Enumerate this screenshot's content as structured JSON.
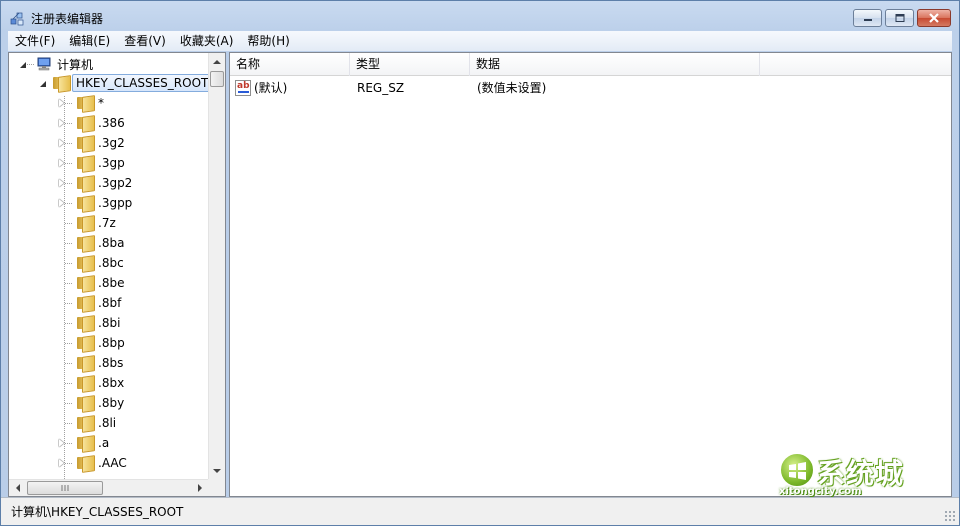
{
  "window": {
    "title": "注册表编辑器"
  },
  "menu": [
    {
      "label": "文件(F)"
    },
    {
      "label": "编辑(E)"
    },
    {
      "label": "查看(V)"
    },
    {
      "label": "收藏夹(A)"
    },
    {
      "label": "帮助(H)"
    }
  ],
  "tree": {
    "root_label": "计算机",
    "selected_label": "HKEY_CLASSES_ROOT",
    "children": [
      {
        "label": "*",
        "expandable": true
      },
      {
        "label": ".386",
        "expandable": true
      },
      {
        "label": ".3g2",
        "expandable": true
      },
      {
        "label": ".3gp",
        "expandable": true
      },
      {
        "label": ".3gp2",
        "expandable": true
      },
      {
        "label": ".3gpp",
        "expandable": true
      },
      {
        "label": ".7z",
        "expandable": false
      },
      {
        "label": ".8ba",
        "expandable": false
      },
      {
        "label": ".8bc",
        "expandable": false
      },
      {
        "label": ".8be",
        "expandable": false
      },
      {
        "label": ".8bf",
        "expandable": false
      },
      {
        "label": ".8bi",
        "expandable": false
      },
      {
        "label": ".8bp",
        "expandable": false
      },
      {
        "label": ".8bs",
        "expandable": false
      },
      {
        "label": ".8bx",
        "expandable": false
      },
      {
        "label": ".8by",
        "expandable": false
      },
      {
        "label": ".8li",
        "expandable": false
      },
      {
        "label": ".a",
        "expandable": true
      },
      {
        "label": ".AAC",
        "expandable": true
      }
    ]
  },
  "list": {
    "columns": [
      {
        "label": "名称"
      },
      {
        "label": "类型"
      },
      {
        "label": "数据"
      }
    ],
    "rows": [
      {
        "name": "(默认)",
        "type": "REG_SZ",
        "data": "(数值未设置)",
        "icon": "string-value-icon"
      }
    ]
  },
  "statusbar": {
    "path": "计算机\\HKEY_CLASSES_ROOT"
  },
  "watermark": {
    "text": "系统城",
    "url": "xitongcity.com"
  },
  "colors": {
    "frame": "#b9cde8",
    "selection_border": "#84acdd",
    "close_button": "#c74a31",
    "watermark_green": "#7cb82a"
  }
}
